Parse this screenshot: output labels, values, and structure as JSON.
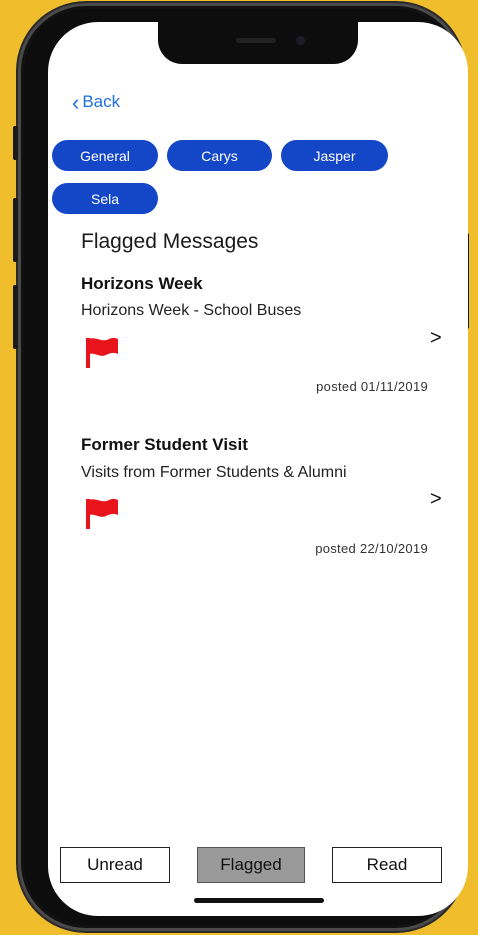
{
  "nav": {
    "back_label": "Back"
  },
  "groups": [
    "General",
    "Carys",
    "Jasper",
    "Sela"
  ],
  "section_title": "Flagged Messages",
  "messages": [
    {
      "title": "Horizons Week",
      "subtitle": "Horizons Week - School Buses",
      "posted": "posted 01/11/2019",
      "flagged": true,
      "arrow": ">"
    },
    {
      "title": "Former Student Visit",
      "subtitle": "Visits from Former Students & Alumni",
      "posted": "posted 22/10/2019",
      "flagged": true,
      "arrow": ">"
    }
  ],
  "tabs": [
    {
      "label": "Unread",
      "active": false
    },
    {
      "label": "Flagged",
      "active": true
    },
    {
      "label": "Read",
      "active": false
    }
  ],
  "colors": {
    "background": "#f0bd2c",
    "chip": "#1446c8",
    "back": "#1f6fe0",
    "flag": "#e8141c",
    "active_tab": "#9a9a9a"
  }
}
